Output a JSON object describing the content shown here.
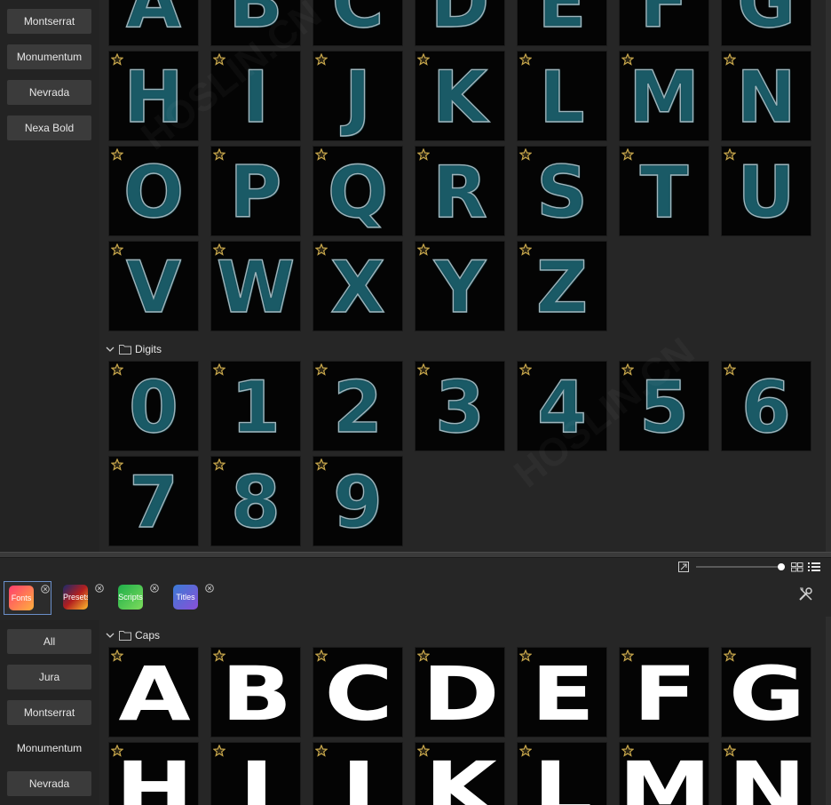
{
  "top_panel": {
    "sidebar": [
      "Montserrat",
      "Monumentum",
      "Nevrada",
      "Nexa Bold"
    ],
    "caps_rows": [
      [
        "A",
        "B",
        "C",
        "D",
        "E",
        "F",
        "G"
      ],
      [
        "H",
        "I",
        "J",
        "K",
        "L",
        "M",
        "N"
      ],
      [
        "O",
        "P",
        "Q",
        "R",
        "S",
        "T",
        "U"
      ],
      [
        "V",
        "W",
        "X",
        "Y",
        "Z"
      ]
    ],
    "digits_header": "Digits",
    "digits_rows": [
      [
        "0",
        "1",
        "2",
        "3",
        "4",
        "5",
        "6"
      ],
      [
        "7",
        "8",
        "9"
      ]
    ]
  },
  "bottom_panel": {
    "tabs": [
      {
        "label": "Fonts"
      },
      {
        "label": "Presets"
      },
      {
        "label": "Scripts"
      },
      {
        "label": "Titles"
      }
    ],
    "sidebar": [
      "All",
      "Jura",
      "Montserrat",
      "Monumentum",
      "Nevrada"
    ],
    "caps_header": "Caps",
    "caps_rows": [
      [
        "A",
        "B",
        "C",
        "D",
        "E",
        "F",
        "G"
      ],
      [
        "H",
        "I",
        "J",
        "K",
        "L",
        "M",
        "N"
      ]
    ]
  },
  "colors": {
    "star": "#c9a84c",
    "accent_border": "#6a8fc9",
    "fonts_tab_gradient": "linear-gradient(135deg,#ff3d6e,#ffb13d)",
    "presets_tab_gradient": "linear-gradient(135deg,#1a2a6c,#b21f1f,#fdbb2d)",
    "scripts_tab_gradient": "linear-gradient(135deg,#1fae4a,#7ddc5c)",
    "titles_tab_gradient": "linear-gradient(135deg,#3a7bd5,#8a4fd8)"
  },
  "icons": {
    "favorite": "star-icon",
    "folder": "folder-icon",
    "collapse": "chevron-down-icon",
    "tab_close": "close-circle-icon",
    "fit": "fit-view-icon",
    "grid_view": "grid-view-icon",
    "list_view": "list-view-icon",
    "settings": "tools-icon"
  }
}
